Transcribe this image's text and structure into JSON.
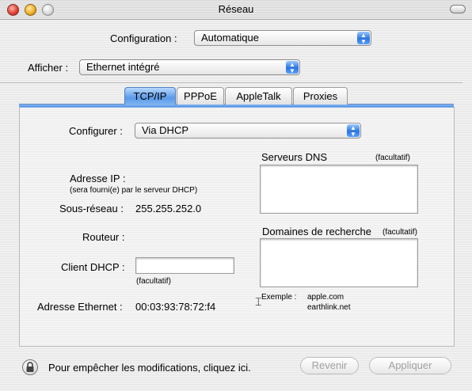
{
  "window": {
    "title": "Réseau"
  },
  "configuration": {
    "label": "Configuration :",
    "value": "Automatique"
  },
  "afficher": {
    "label": "Afficher :",
    "value": "Ethernet intégré"
  },
  "tabs": [
    {
      "label": "TCP/IP"
    },
    {
      "label": "PPPoE"
    },
    {
      "label": "AppleTalk"
    },
    {
      "label": "Proxies"
    }
  ],
  "tcpip": {
    "configurer_label": "Configurer :",
    "configurer_value": "Via DHCP",
    "dns_label": "Serveurs DNS",
    "dns_optional": "(facultatif)",
    "ip_label": "Adresse IP :",
    "ip_note": "(sera fourni(e) par le serveur DHCP)",
    "subnet_label": "Sous-réseau :",
    "subnet_value": "255.255.252.0",
    "router_label": "Routeur :",
    "search_domains_label": "Domaines de recherche",
    "search_domains_optional": "(facultatif)",
    "dhcp_client_label": "Client DHCP :",
    "dhcp_client_value": "",
    "dhcp_optional": "(facultatif)",
    "example_label": "Exemple :",
    "example_1": "apple.com",
    "example_2": "earthlink.net",
    "ethernet_label": "Adresse Ethernet :",
    "ethernet_value": "00:03:93:78:72:f4"
  },
  "footer": {
    "lock_text": "Pour empêcher les modifications, cliquez ici.",
    "revert_label": "Revenir",
    "apply_label": "Appliquer"
  }
}
